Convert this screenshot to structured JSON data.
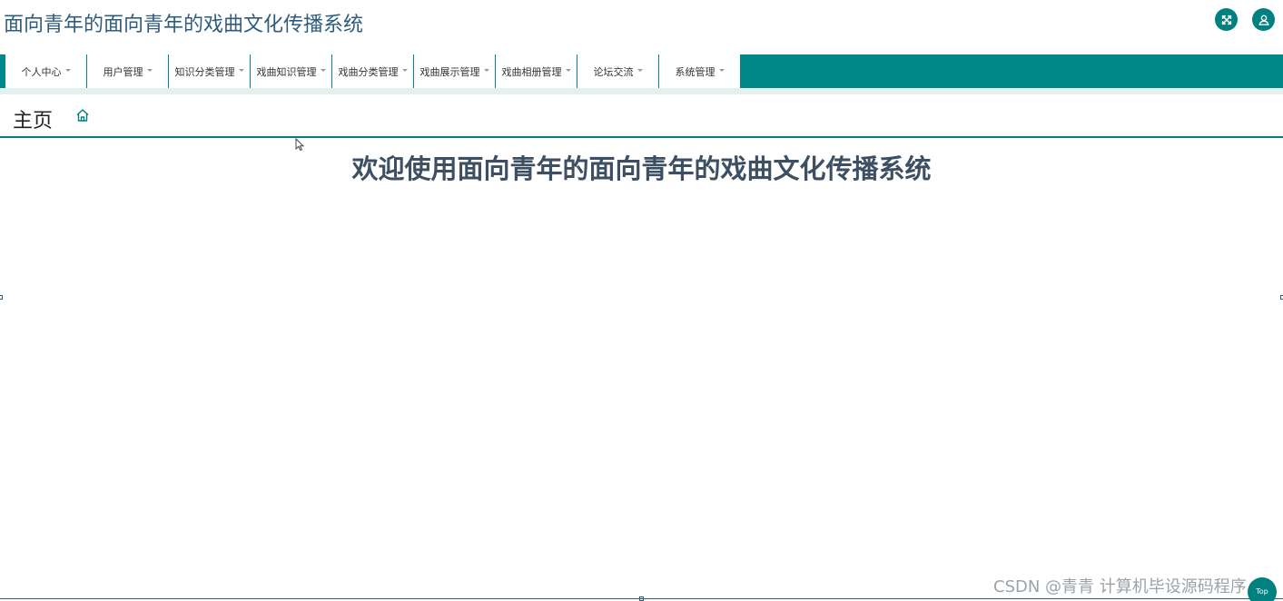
{
  "header": {
    "title": "面向青年的面向青年的戏曲文化传播系统",
    "fullscreen_icon": "fullscreen-icon",
    "user_icon": "user-icon",
    "accent_color": "#008080"
  },
  "nav": {
    "items": [
      {
        "label": "个人中心"
      },
      {
        "label": "用户管理"
      },
      {
        "label": "知识分类管理"
      },
      {
        "label": "戏曲知识管理"
      },
      {
        "label": "戏曲分类管理"
      },
      {
        "label": "戏曲展示管理"
      },
      {
        "label": "戏曲相册管理"
      },
      {
        "label": "论坛交流"
      },
      {
        "label": "系统管理"
      }
    ],
    "bar_color": "#008787"
  },
  "breadcrumb": {
    "title": "主页",
    "icon": "home-icon"
  },
  "main": {
    "welcome": "欢迎使用面向青年的面向青年的戏曲文化传播系统"
  },
  "watermark": "CSDN @青青  计算机毕设源码程序",
  "top_button": {
    "label": "Top"
  }
}
